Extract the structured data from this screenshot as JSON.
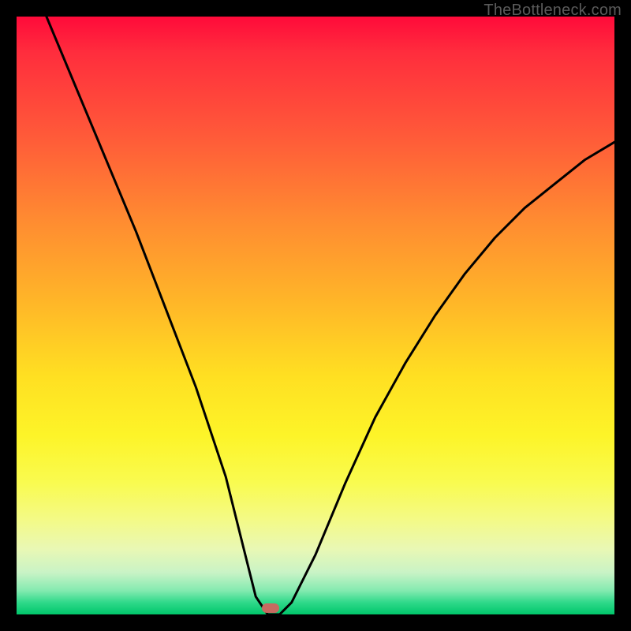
{
  "watermark": "TheBottleneck.com",
  "marker": {
    "x_pct": 42.5,
    "y_pct": 99.0,
    "color": "#c76a60"
  },
  "chart_data": {
    "type": "line",
    "title": "",
    "xlabel": "",
    "ylabel": "",
    "xlim": [
      0,
      100
    ],
    "ylim": [
      0,
      100
    ],
    "grid": false,
    "legend": false,
    "background_gradient": {
      "orientation": "vertical",
      "stops": [
        {
          "pct": 0,
          "color": "#ff0a3a"
        },
        {
          "pct": 50,
          "color": "#ffbf25"
        },
        {
          "pct": 78,
          "color": "#f9fb50"
        },
        {
          "pct": 100,
          "color": "#00c66a"
        }
      ]
    },
    "series": [
      {
        "name": "bottleneck-curve",
        "color": "#000000",
        "x": [
          5,
          10,
          15,
          20,
          25,
          30,
          35,
          38,
          40,
          42,
          44,
          46,
          50,
          55,
          60,
          65,
          70,
          75,
          80,
          85,
          90,
          95,
          100
        ],
        "y": [
          100,
          88,
          76,
          64,
          51,
          38,
          23,
          11,
          3,
          0,
          0,
          2,
          10,
          22,
          33,
          42,
          50,
          57,
          63,
          68,
          72,
          76,
          79
        ]
      }
    ],
    "markers": [
      {
        "name": "optimal-point",
        "x": 42.5,
        "y": 0,
        "shape": "rounded-pill",
        "color": "#c76a60"
      }
    ]
  }
}
